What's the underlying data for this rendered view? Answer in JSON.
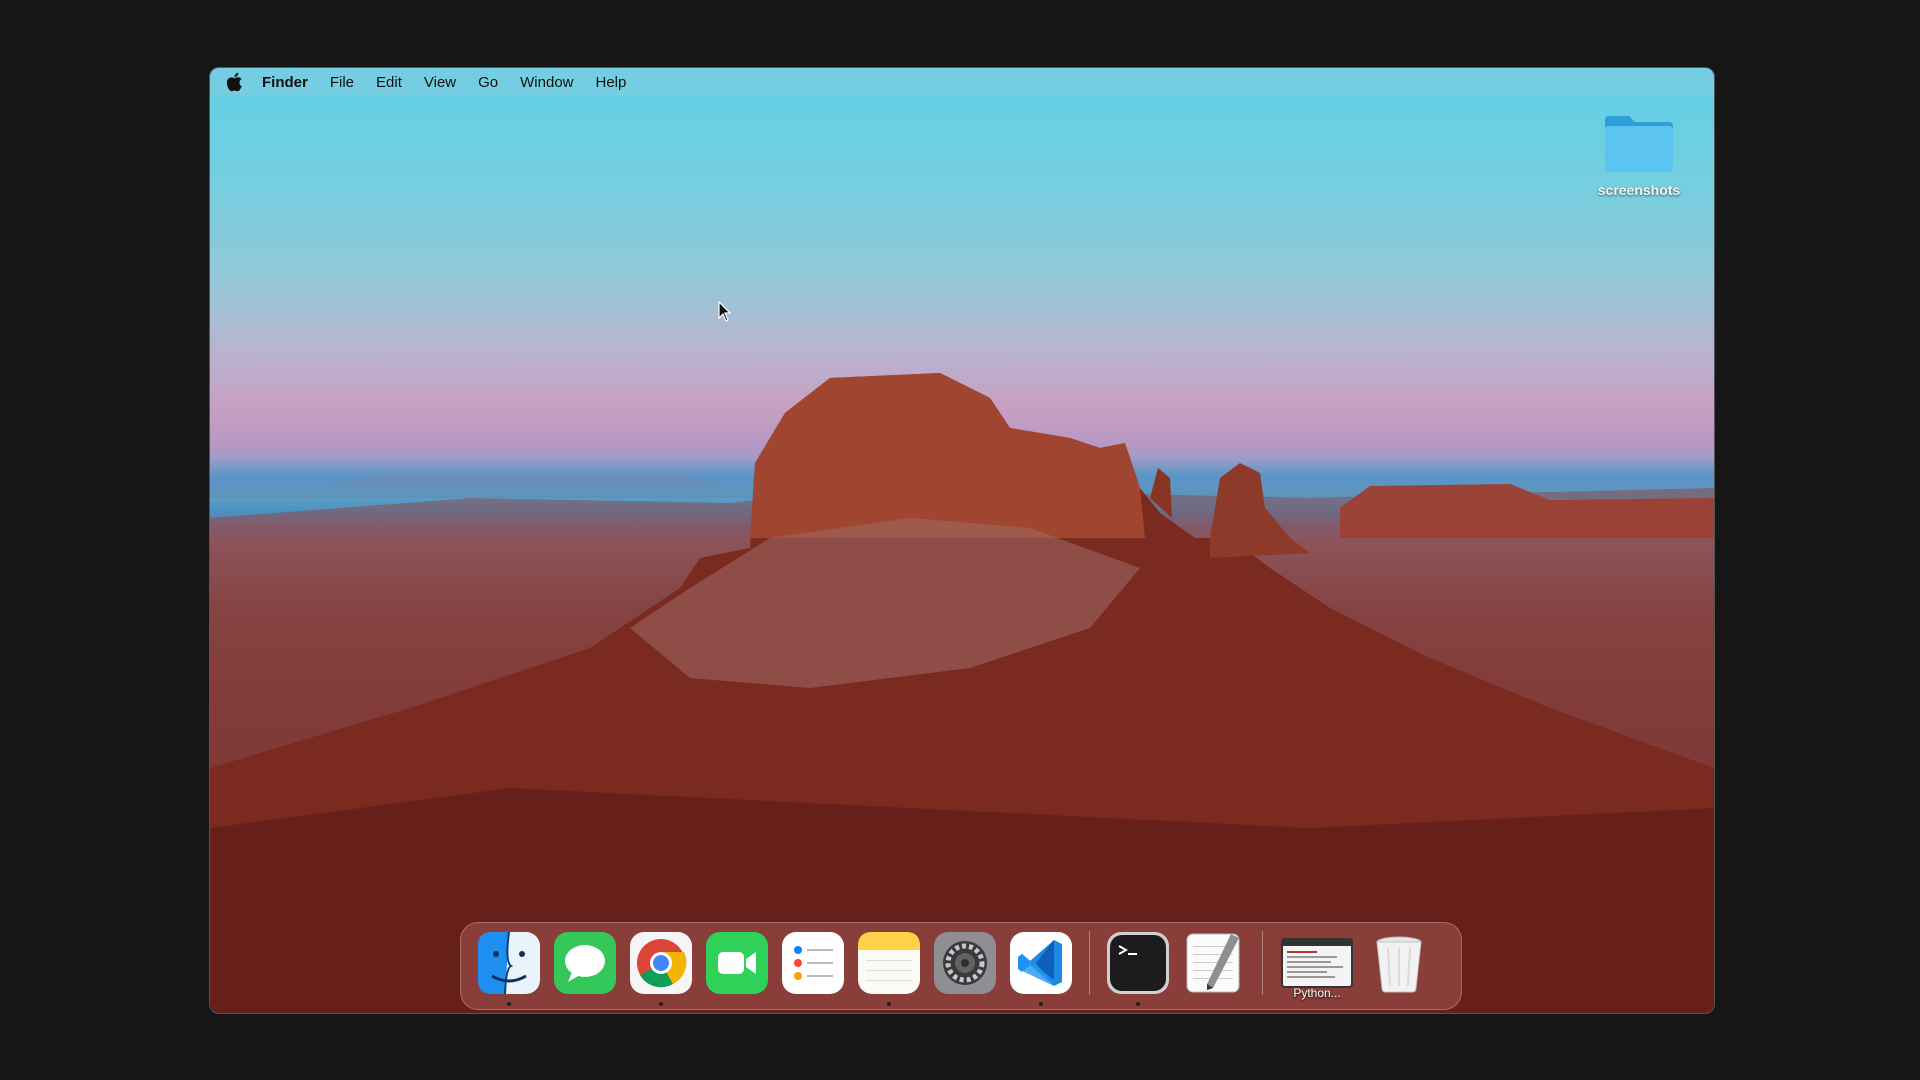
{
  "menubar": {
    "apple_icon": "apple-logo-icon",
    "app_name": "Finder",
    "items": [
      "File",
      "Edit",
      "View",
      "Go",
      "Window",
      "Help"
    ]
  },
  "desktop": {
    "folder_label": "screenshots",
    "folder_icon": "folder-icon"
  },
  "dock": {
    "apps": [
      {
        "name": "Finder",
        "icon": "finder-icon",
        "running": true
      },
      {
        "name": "Messages",
        "icon": "messages-icon",
        "running": false
      },
      {
        "name": "Google Chrome",
        "icon": "chrome-icon",
        "running": true
      },
      {
        "name": "FaceTime",
        "icon": "facetime-icon",
        "running": false
      },
      {
        "name": "Reminders",
        "icon": "reminders-icon",
        "running": false
      },
      {
        "name": "Notes",
        "icon": "notes-icon",
        "running": true
      },
      {
        "name": "System Settings",
        "icon": "settings-gear-icon",
        "running": false
      },
      {
        "name": "Visual Studio Code",
        "icon": "vscode-icon",
        "running": true
      },
      {
        "name": "Terminal",
        "icon": "terminal-icon",
        "running": true
      },
      {
        "name": "TextEdit",
        "icon": "textedit-icon",
        "running": false
      }
    ],
    "minimized_window_label": "Python...",
    "trash_icon": "trash-icon"
  },
  "colors": {
    "menubar": "#78cde1",
    "folder": "#48b6e8",
    "dock": "#c87878"
  }
}
